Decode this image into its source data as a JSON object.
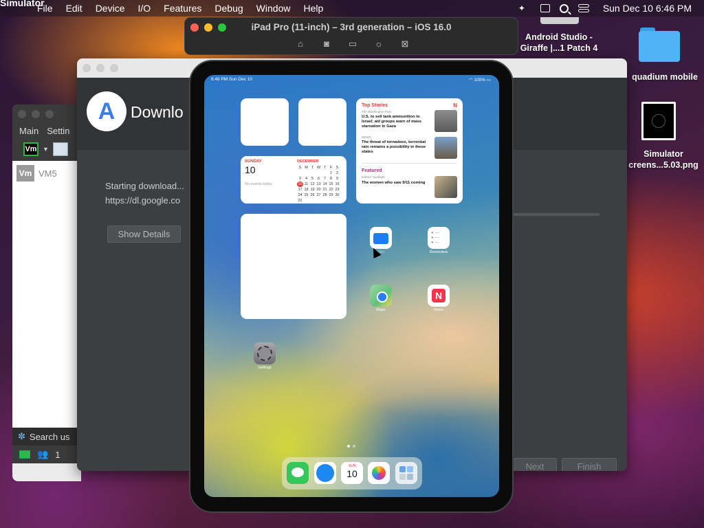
{
  "menubar": {
    "app_name": "Simulator",
    "items": [
      "File",
      "Edit",
      "Device",
      "I/O",
      "Features",
      "Debug",
      "Window",
      "Help"
    ],
    "clock": "Sun Dec 10  6:46 PM"
  },
  "simulator_window": {
    "title": "iPad Pro (11-inch) – 3rd generation – iOS 16.0",
    "tools": [
      "home-icon",
      "screenshot-icon",
      "rotate-icon",
      "brightness-icon",
      "shake-icon"
    ]
  },
  "desktop": {
    "android_studio_label": "Android Studio -\nGiraffe |...1 Patch 4",
    "folder_label": "quadium mobile",
    "screenshot_label": "Simulator\ncreens...5.03.png"
  },
  "vm_window": {
    "menu": [
      "Main",
      "Settin"
    ],
    "vm_name": "VM5",
    "vm_badge": "Vm",
    "search_placeholder": "Search us",
    "user_count": "1"
  },
  "android_studio": {
    "title": "Downlo",
    "message_line1": "Starting download...",
    "message_line2": "https://dl.google.co",
    "show_details": "Show Details",
    "next": "Next",
    "finish": "Finish"
  },
  "ipad": {
    "status_time": "6:46 PM   Sun Dec 10",
    "battery": "100%",
    "calendar": {
      "weekday": "SUNDAY",
      "date": "10",
      "no_events": "No events today",
      "month": "DECEMBER",
      "days_header": [
        "S",
        "M",
        "T",
        "W",
        "T",
        "F",
        "S"
      ],
      "weeks": [
        [
          "",
          "",
          "",
          "",
          "",
          "1",
          "2"
        ],
        [
          "3",
          "4",
          "5",
          "6",
          "7",
          "8",
          "9"
        ],
        [
          "10",
          "11",
          "12",
          "13",
          "14",
          "15",
          "16"
        ],
        [
          "17",
          "18",
          "19",
          "20",
          "21",
          "22",
          "23"
        ],
        [
          "24",
          "25",
          "26",
          "27",
          "28",
          "29",
          "30"
        ],
        [
          "31",
          "",
          "",
          "",
          "",
          "",
          ""
        ]
      ]
    },
    "news": {
      "top_stories": "Top Stories",
      "source1": "The Washington Post",
      "headline1": "U.S. to sell tank ammunition to Israel; aid groups warn of mass starvation in Gaza",
      "source2": "NEWS",
      "headline2": "The threat of tornadoes, torrential rain remains a possibility in these states",
      "featured": "Featured",
      "source3": "Editors' Spotlight",
      "headline3": "The women who saw 9/11 coming"
    },
    "apps": [
      {
        "name": "Files",
        "color": "#1a7df0"
      },
      {
        "name": "Reminders",
        "color": "#ffffff"
      },
      {
        "name": "Maps",
        "color": "#62c07a"
      },
      {
        "name": "News",
        "color": "#f4f4f4"
      },
      {
        "name": "Settings",
        "color": "#8e8e93"
      }
    ],
    "dock": [
      {
        "name": "messages-icon",
        "color": "#35c759"
      },
      {
        "name": "safari-icon",
        "color": "#1e88f0"
      },
      {
        "name": "calendar-icon",
        "color": "#ffffff",
        "day": "SUN",
        "date": "10"
      },
      {
        "name": "photos-icon",
        "color": "#ffffff"
      },
      {
        "name": "app-library-icon",
        "color": "#e9eef0"
      }
    ]
  }
}
